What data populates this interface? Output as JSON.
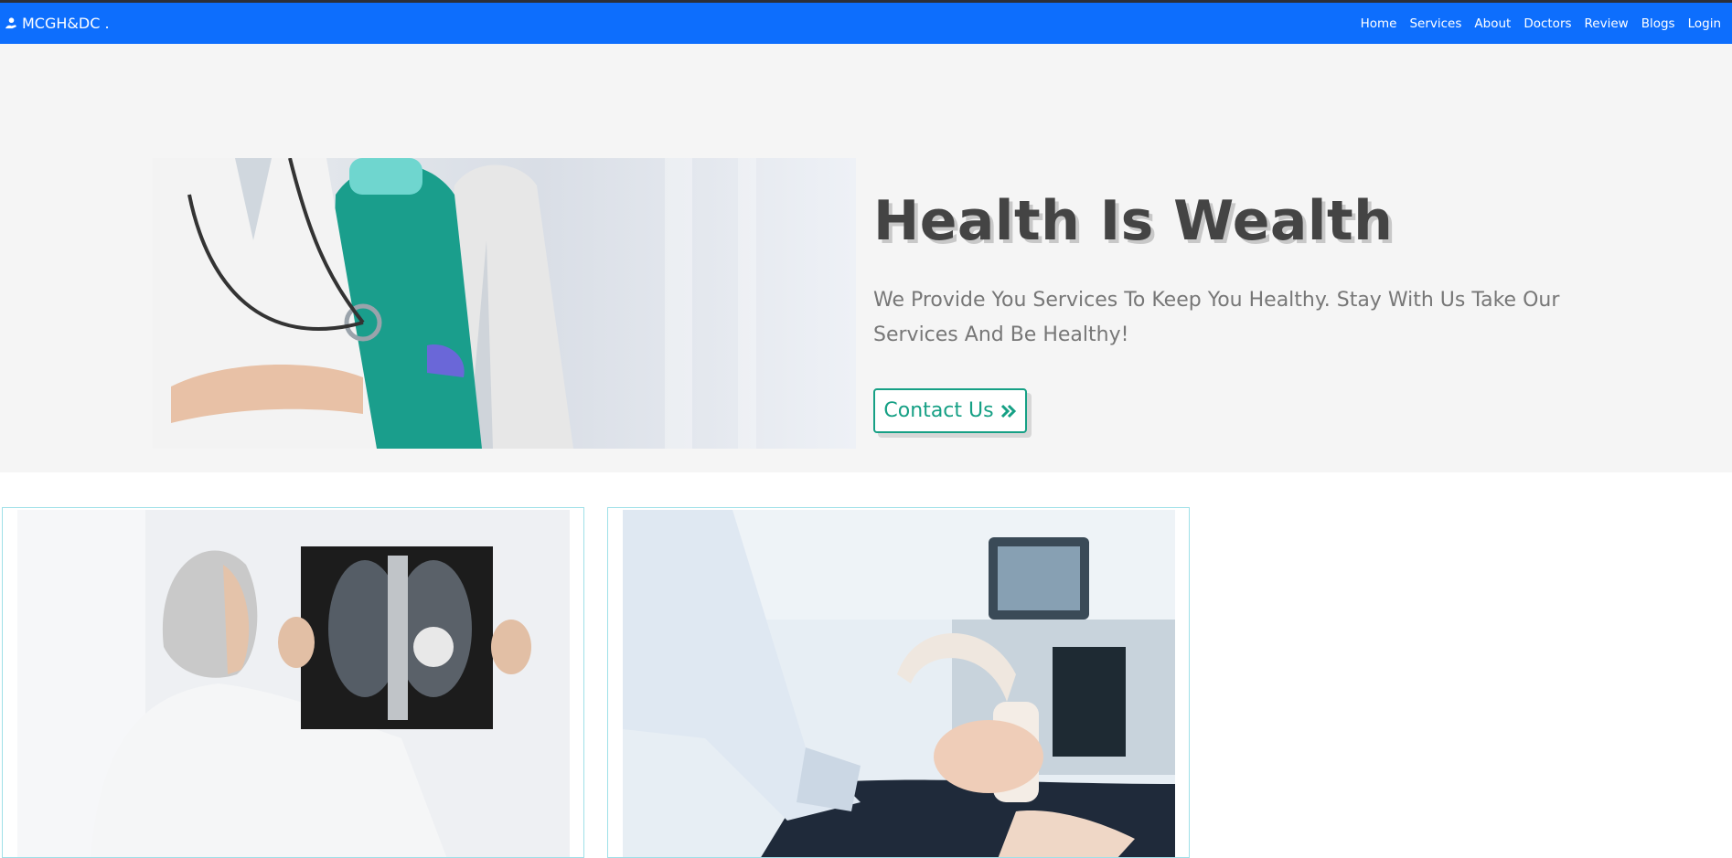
{
  "header": {
    "brand_icon": "user-hand-icon",
    "brand_name": "MCGH&DC .",
    "nav": [
      "Home",
      "Services",
      "About",
      "Doctors",
      "Review",
      "Blogs",
      "Login"
    ]
  },
  "hero": {
    "title": "Health Is Wealth",
    "description": "We Provide You Services To Keep You Healthy. Stay With Us Take Our Services And Be Healthy!",
    "cta_label": "Contact Us",
    "cta_icon": "double-chevron-right-icon"
  },
  "colors": {
    "navbar": "#0d6efd",
    "accent": "#16a085",
    "card_border": "#9fe0e8"
  }
}
